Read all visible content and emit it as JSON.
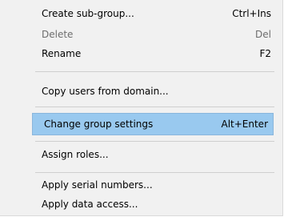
{
  "menu": {
    "items": [
      {
        "label": "Create sub-group...",
        "shortcut": "Ctrl+Ins"
      },
      {
        "label": "Delete",
        "shortcut": "Del"
      },
      {
        "label": "Rename",
        "shortcut": "F2"
      },
      {
        "label": "Copy users from domain...",
        "shortcut": ""
      },
      {
        "label": "Change group settings",
        "shortcut": "Alt+Enter"
      },
      {
        "label": "Assign roles...",
        "shortcut": ""
      },
      {
        "label": "Apply serial numbers...",
        "shortcut": ""
      },
      {
        "label": "Apply data access...",
        "shortcut": ""
      }
    ]
  },
  "colors": {
    "selection_bg": "#99c9ef",
    "disabled_text": "#6d6d6d",
    "menu_bg": "#f1f1f1"
  }
}
